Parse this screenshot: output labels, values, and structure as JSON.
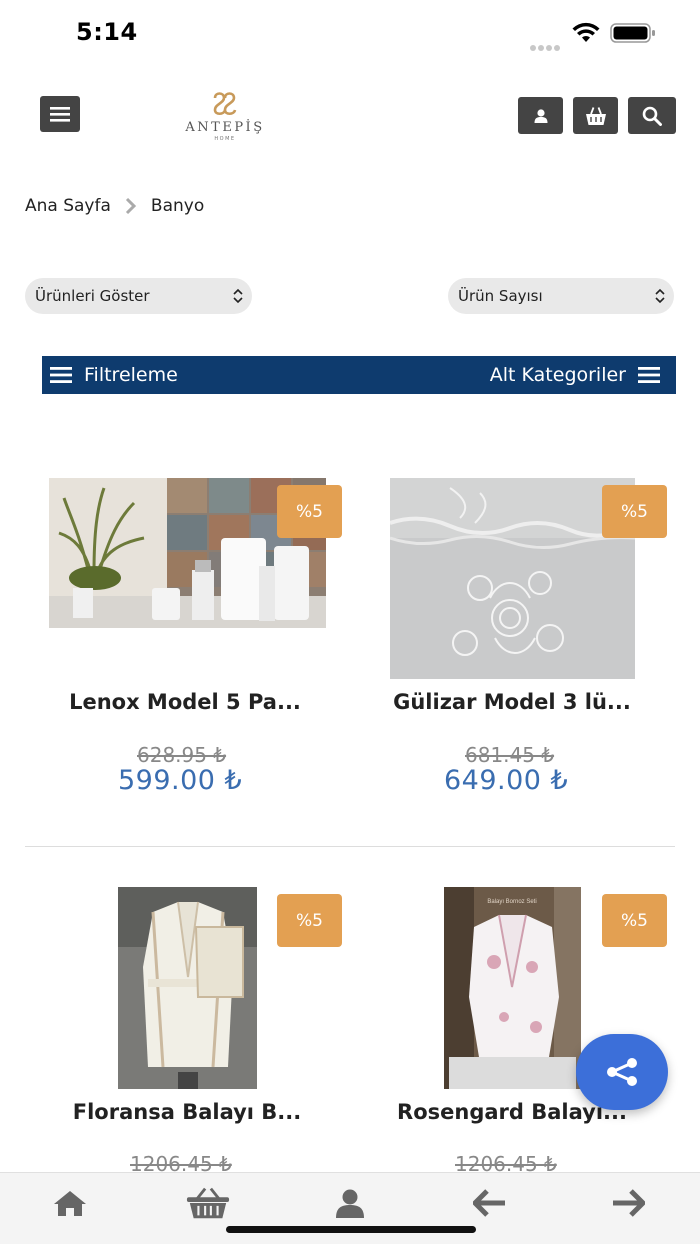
{
  "status_bar": {
    "time": "5:14"
  },
  "header": {
    "logo_text": "ANTEPİŞ",
    "logo_sub": "HOME"
  },
  "breadcrumb": {
    "home": "Ana Sayfa",
    "current": "Banyo"
  },
  "selects": {
    "sort": "Ürünleri Göster",
    "count": "Ürün Sayısı"
  },
  "filter_bar": {
    "filter_label": "Filtreleme",
    "subcat_label": "Alt Kategoriler"
  },
  "products": [
    {
      "name": "Lenox Model 5 Pa...",
      "badge": "%5",
      "old_price": "628.95 ₺",
      "new_price": "599.00 ₺"
    },
    {
      "name": "Gülizar Model 3 lü...",
      "badge": "%5",
      "old_price": "681.45 ₺",
      "new_price": "649.00 ₺"
    },
    {
      "name": "Floransa Balayı B...",
      "badge": "%5",
      "old_price": "1206.45 ₺",
      "new_price": ""
    },
    {
      "name": "Rosengard Balayı...",
      "badge": "%5",
      "old_price": "1206.45 ₺",
      "new_price": ""
    }
  ],
  "product_image_caption": "Balayı Bornoz Seti",
  "colors": {
    "accent": "#0e3b6e",
    "badge": "#e3a052",
    "price": "#3a6db0",
    "fab": "#3c6fd9",
    "header_btn": "#444444"
  },
  "bottom_nav": [
    "home-icon",
    "basket-icon",
    "user-icon",
    "arrow-left-icon",
    "arrow-right-icon"
  ]
}
